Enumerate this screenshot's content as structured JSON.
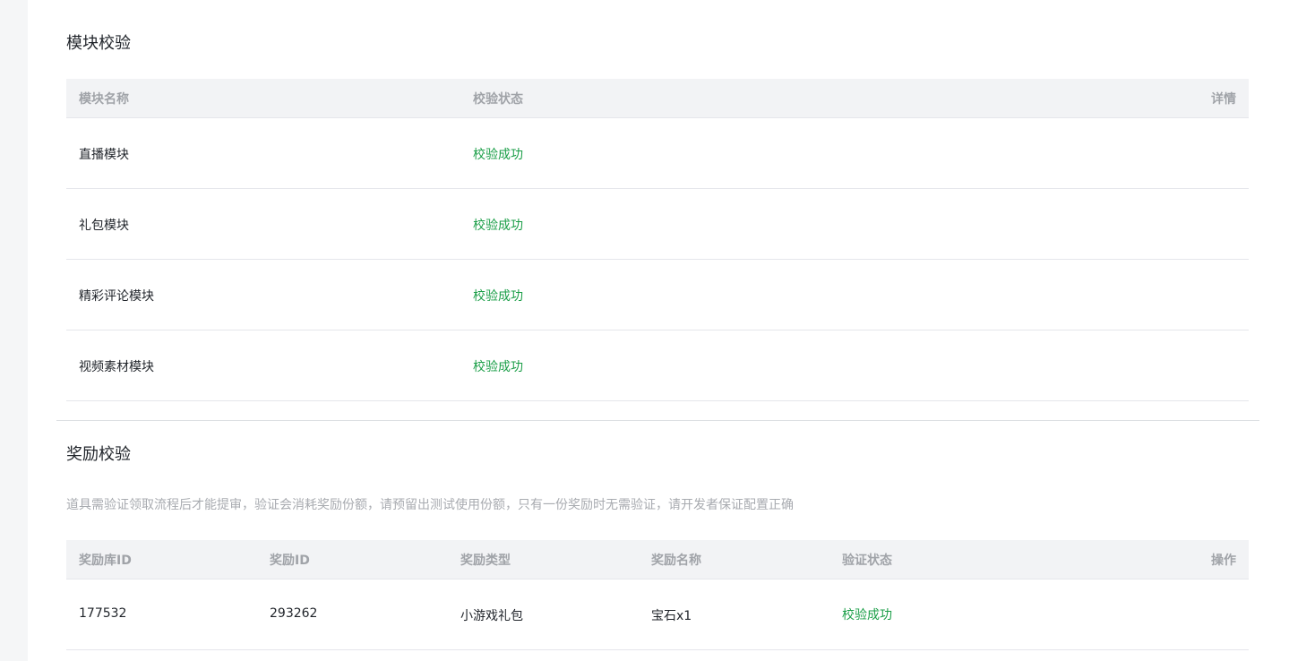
{
  "module_section": {
    "title": "模块校验",
    "headers": {
      "name": "模块名称",
      "status": "校验状态",
      "detail": "详情"
    },
    "rows": [
      {
        "name": "直播模块",
        "status": "校验成功"
      },
      {
        "name": "礼包模块",
        "status": "校验成功"
      },
      {
        "name": "精彩评论模块",
        "status": "校验成功"
      },
      {
        "name": "视频素材模块",
        "status": "校验成功"
      }
    ]
  },
  "reward_section": {
    "title": "奖励校验",
    "description": "道具需验证领取流程后才能提审，验证会消耗奖励份额，请预留出测试使用份额，只有一份奖励时无需验证，请开发者保证配置正确",
    "headers": {
      "library_id": "奖励库ID",
      "reward_id": "奖励ID",
      "type": "奖励类型",
      "name": "奖励名称",
      "status": "验证状态",
      "action": "操作"
    },
    "rows": [
      {
        "library_id": "177532",
        "reward_id": "293262",
        "type": "小游戏礼包",
        "name": "宝石x1",
        "status": "校验成功"
      }
    ]
  },
  "colors": {
    "success": "#1a9e47",
    "header_bg": "#f2f3f5"
  }
}
